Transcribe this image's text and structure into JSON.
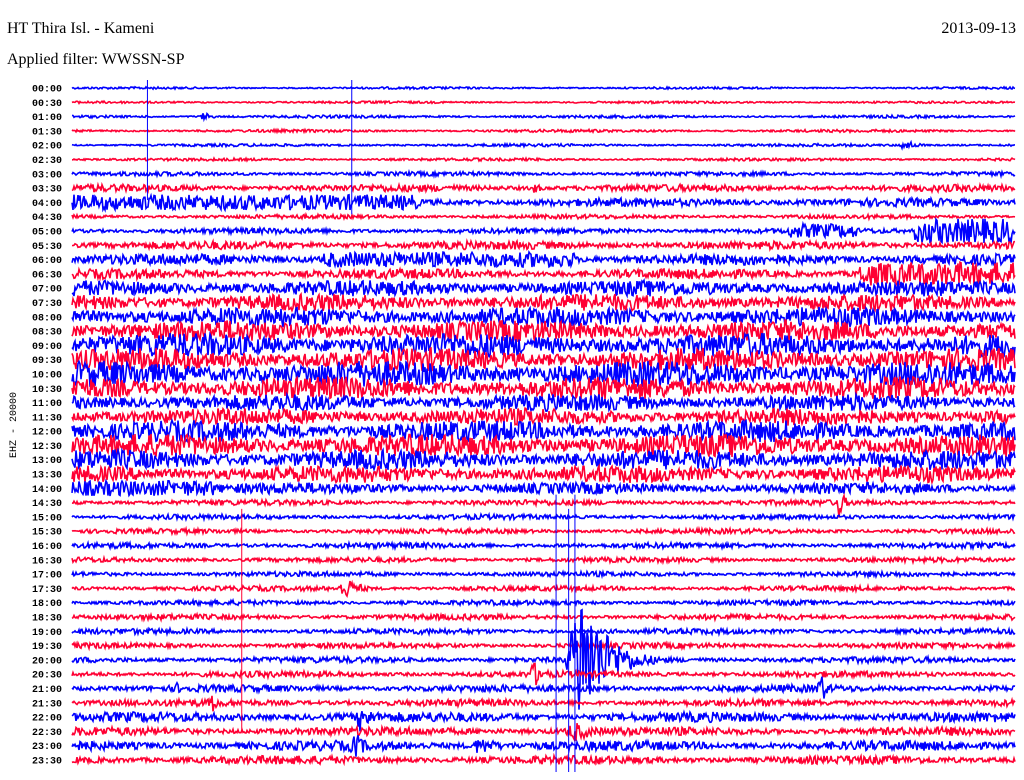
{
  "header": {
    "station": "HT Thira Isl. - Kameni",
    "date": "2013-09-13",
    "filter": "Applied filter: WWSSN-SP"
  },
  "chart_data": {
    "type": "line",
    "title": "HT Thira Isl. - Kameni",
    "ylabel": "EHZ - 20000",
    "row_minutes": 30,
    "colors": [
      "#0000ff",
      "#ff0033"
    ],
    "rows": [
      "00:00",
      "00:30",
      "01:00",
      "01:30",
      "02:00",
      "02:30",
      "03:00",
      "03:30",
      "04:00",
      "04:30",
      "05:00",
      "05:30",
      "06:00",
      "06:30",
      "07:00",
      "07:30",
      "08:00",
      "08:30",
      "09:00",
      "09:30",
      "10:00",
      "10:30",
      "11:00",
      "11:30",
      "12:00",
      "12:30",
      "13:00",
      "13:30",
      "14:00",
      "14:30",
      "15:00",
      "15:30",
      "16:00",
      "16:30",
      "17:00",
      "17:30",
      "18:00",
      "18:30",
      "19:00",
      "19:30",
      "20:00",
      "20:30",
      "21:00",
      "21:30",
      "22:00",
      "22:30",
      "23:00",
      "23:30"
    ],
    "noise_level": [
      0.08,
      0.08,
      0.1,
      0.1,
      0.1,
      0.1,
      0.15,
      0.25,
      0.3,
      0.15,
      0.2,
      0.3,
      0.4,
      0.35,
      0.55,
      0.6,
      0.7,
      0.75,
      0.85,
      0.8,
      0.9,
      0.8,
      0.6,
      0.6,
      0.75,
      0.8,
      0.7,
      0.6,
      0.4,
      0.2,
      0.18,
      0.18,
      0.2,
      0.18,
      0.18,
      0.18,
      0.18,
      0.2,
      0.2,
      0.2,
      0.22,
      0.22,
      0.25,
      0.25,
      0.35,
      0.3,
      0.35,
      0.3
    ],
    "events": [
      {
        "row": "01:00",
        "minute": 4.2,
        "amp": 0.35,
        "duration": 0.6
      },
      {
        "row": "02:00",
        "minute": 26.5,
        "amp": 0.45,
        "duration": 0.8
      },
      {
        "row": "03:30",
        "minute": 0.7,
        "amp": 0.45,
        "duration": 0.6
      },
      {
        "row": "03:30",
        "minute": 3.1,
        "amp": 0.45,
        "duration": 0.5
      },
      {
        "row": "03:30",
        "minute": 14.7,
        "amp": 0.5,
        "duration": 0.5
      },
      {
        "row": "04:00",
        "minute": 5.5,
        "amp": 0.6,
        "duration": 11
      },
      {
        "row": "05:00",
        "minute": 23.9,
        "amp": 0.55,
        "duration": 2.2
      },
      {
        "row": "05:00",
        "minute": 28.4,
        "amp": 0.95,
        "duration": 3.2
      },
      {
        "row": "06:00",
        "minute": 12,
        "amp": 0.6,
        "duration": 8
      },
      {
        "row": "06:30",
        "minute": 27.5,
        "amp": 0.9,
        "duration": 5
      },
      {
        "row": "14:00",
        "minute": 2,
        "amp": 0.6,
        "duration": 5
      },
      {
        "row": "14:30",
        "minute": 24.4,
        "amp": 1.3,
        "duration": 0.4
      },
      {
        "row": "17:30",
        "minute": 8.7,
        "amp": 0.9,
        "duration": 1
      },
      {
        "row": "20:00",
        "minute": 16.2,
        "amp": 5.5,
        "duration": 1.8
      },
      {
        "row": "20:30",
        "minute": 14.7,
        "amp": 1.0,
        "duration": 0.8
      },
      {
        "row": "21:00",
        "minute": 23.8,
        "amp": 1.4,
        "duration": 0.5
      },
      {
        "row": "21:00",
        "minute": 3.3,
        "amp": 0.6,
        "duration": 0.4
      },
      {
        "row": "21:30",
        "minute": 4.5,
        "amp": 0.8,
        "duration": 0.5
      },
      {
        "row": "22:00",
        "minute": 9.2,
        "amp": 1.2,
        "duration": 0.8
      },
      {
        "row": "22:30",
        "minute": 16,
        "amp": 0.8,
        "duration": 1.5
      },
      {
        "row": "23:00",
        "minute": 9,
        "amp": 1.1,
        "duration": 0.8
      },
      {
        "row": "23:00",
        "minute": 13,
        "amp": 0.7,
        "duration": 1.5
      }
    ],
    "spikes": [
      {
        "minute": 2.4,
        "from_row": "00:00",
        "to_row": "03:30",
        "color": "#0000ff"
      },
      {
        "minute": 8.9,
        "from_row": "00:00",
        "to_row": "04:00",
        "color": "#0000ff"
      },
      {
        "minute": 5.4,
        "from_row": "15:00",
        "to_row": "22:00",
        "color": "#ff0033"
      },
      {
        "minute": 15.4,
        "from_row": "14:30",
        "to_row": "23:30",
        "color": "#0000ff"
      },
      {
        "minute": 15.8,
        "from_row": "15:00",
        "to_row": "23:30",
        "color": "#0000ff"
      },
      {
        "minute": 16.0,
        "from_row": "14:30",
        "to_row": "23:30",
        "color": "#0000ff"
      }
    ]
  }
}
